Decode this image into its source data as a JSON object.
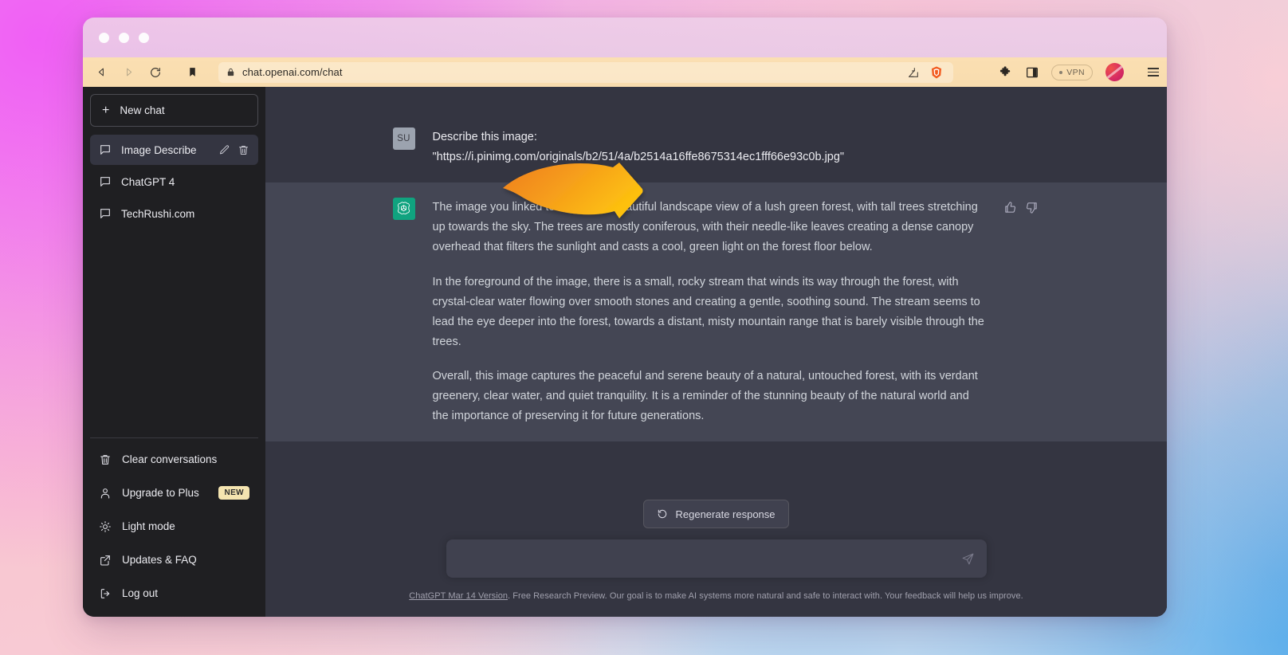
{
  "browser": {
    "url": "chat.openai.com/chat",
    "nav": {
      "back": "back-icon",
      "forward": "forward-icon",
      "reload": "reload-icon",
      "bookmark": "bookmark-icon",
      "share": "share-icon",
      "shield": "brave-shield-icon"
    },
    "extensions": [
      "crescent-extension-icon",
      "puzzle-extension-icon",
      "sidebar-panel-icon"
    ],
    "vpn_label": "VPN",
    "window_controls": [
      "close",
      "minimize",
      "maximize"
    ]
  },
  "sidebar": {
    "new_chat_label": "New chat",
    "conversations": [
      {
        "label": "Image Describe",
        "active": true
      },
      {
        "label": "ChatGPT 4",
        "active": false
      },
      {
        "label": "TechRushi.com",
        "active": false
      }
    ],
    "footer": [
      {
        "label": "Clear conversations",
        "icon": "trash-icon",
        "badge": ""
      },
      {
        "label": "Upgrade to Plus",
        "icon": "user-icon",
        "badge": "NEW"
      },
      {
        "label": "Light mode",
        "icon": "sun-icon",
        "badge": ""
      },
      {
        "label": "Updates & FAQ",
        "icon": "external-link-icon",
        "badge": ""
      },
      {
        "label": "Log out",
        "icon": "logout-icon",
        "badge": ""
      }
    ]
  },
  "chat": {
    "user": {
      "avatar_initials": "SU",
      "line1": "Describe this image:",
      "line2": "\"https://i.pinimg.com/originals/b2/51/4a/b2514a16ffe8675314ec1fff66e93c0b.jpg\""
    },
    "assistant": {
      "paragraph1": "The image you linked to features a beautiful landscape view of a lush green forest, with tall trees stretching up towards the sky. The trees are mostly coniferous, with their needle-like leaves creating a dense canopy overhead that filters the sunlight and casts a cool, green light on the forest floor below.",
      "paragraph2": "In the foreground of the image, there is a small, rocky stream that winds its way through the forest, with crystal-clear water flowing over smooth stones and creating a gentle, soothing sound. The stream seems to lead the eye deeper into the forest, towards a distant, misty mountain range that is barely visible through the trees.",
      "paragraph3": "Overall, this image captures the peaceful and serene beauty of a natural, untouched forest, with its verdant greenery, clear water, and quiet tranquility. It is a reminder of the stunning beauty of the natural world and the importance of preserving it for future generations.",
      "thumbs_up": "thumbs-up-icon",
      "thumbs_down": "thumbs-down-icon"
    }
  },
  "composer": {
    "regenerate_label": "Regenerate response",
    "input_value": "",
    "input_placeholder": "",
    "send_icon": "send-icon"
  },
  "footer": {
    "version_link": "ChatGPT Mar 14 Version",
    "notice": ". Free Research Preview. Our goal is to make AI systems more natural and safe to interact with. Your feedback will help us improve."
  },
  "colors": {
    "sidebar_bg": "#1f1f22",
    "chat_bg": "#343541",
    "assistant_bg": "#444654",
    "accent_green": "#10a37f",
    "badge_yellow": "#f4e4b0",
    "arrow_orange": "#f47c1f",
    "arrow_yellow": "#fbb615",
    "toolbar_tan": "#fbdfb2"
  }
}
